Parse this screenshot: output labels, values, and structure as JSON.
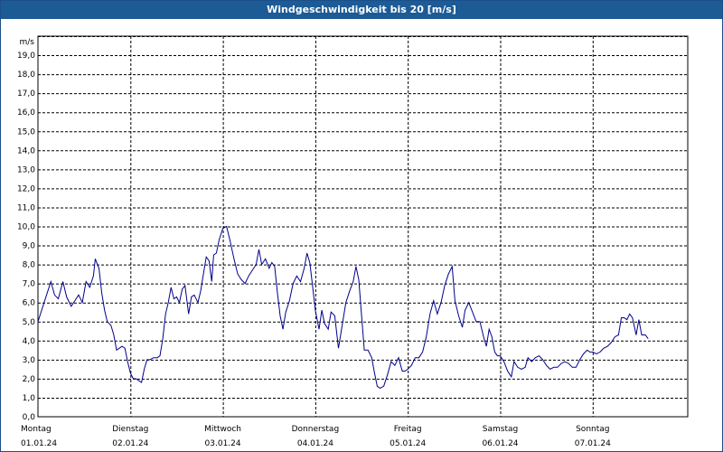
{
  "window": {
    "title": "Windgeschwindigkeit bis 20 [m/s]"
  },
  "chart_data": {
    "type": "line",
    "title": "Windgeschwindigkeit bis 20 [m/s]",
    "ylabel": "m/s",
    "xlabel": "",
    "ylim": [
      0,
      20
    ],
    "grid": true,
    "y_ticks": [
      "0,0",
      "1,0",
      "2,0",
      "3,0",
      "4,0",
      "5,0",
      "6,0",
      "7,0",
      "8,0",
      "9,0",
      "10,0",
      "11,0",
      "12,0",
      "13,0",
      "14,0",
      "15,0",
      "16,0",
      "17,0",
      "18,0",
      "19,0"
    ],
    "x_ticks": [
      {
        "day": "Montag",
        "date": "01.01.24"
      },
      {
        "day": "Dienstag",
        "date": "02.01.24"
      },
      {
        "day": "Mittwoch",
        "date": "03.01.24"
      },
      {
        "day": "Donnerstag",
        "date": "04.01.24"
      },
      {
        "day": "Freitag",
        "date": "05.01.24"
      },
      {
        "day": "Samstag",
        "date": "06.01.24"
      },
      {
        "day": "Sonntag",
        "date": "07.01.24"
      }
    ],
    "series": [
      {
        "color": "#00008b",
        "x_unit": "days since 01.01.24 00:00",
        "points": [
          [
            0.0,
            5.0
          ],
          [
            0.04,
            5.6
          ],
          [
            0.1,
            6.5
          ],
          [
            0.14,
            7.1
          ],
          [
            0.18,
            6.4
          ],
          [
            0.22,
            6.2
          ],
          [
            0.27,
            7.1
          ],
          [
            0.31,
            6.3
          ],
          [
            0.36,
            5.8
          ],
          [
            0.4,
            6.1
          ],
          [
            0.44,
            6.4
          ],
          [
            0.48,
            6.0
          ],
          [
            0.52,
            7.1
          ],
          [
            0.56,
            6.8
          ],
          [
            0.6,
            7.4
          ],
          [
            0.62,
            8.3
          ],
          [
            0.66,
            7.8
          ],
          [
            0.69,
            6.5
          ],
          [
            0.72,
            5.6
          ],
          [
            0.75,
            5.0
          ],
          [
            0.79,
            4.8
          ],
          [
            0.82,
            4.3
          ],
          [
            0.85,
            3.5
          ],
          [
            0.88,
            3.6
          ],
          [
            0.91,
            3.7
          ],
          [
            0.94,
            3.6
          ],
          [
            0.97,
            2.9
          ],
          [
            1.0,
            2.3
          ],
          [
            1.03,
            2.0
          ],
          [
            1.06,
            2.0
          ],
          [
            1.09,
            1.9
          ],
          [
            1.12,
            1.8
          ],
          [
            1.15,
            2.5
          ],
          [
            1.18,
            3.0
          ],
          [
            1.21,
            3.0
          ],
          [
            1.25,
            3.1
          ],
          [
            1.29,
            3.1
          ],
          [
            1.32,
            3.2
          ],
          [
            1.35,
            4.1
          ],
          [
            1.38,
            5.4
          ],
          [
            1.41,
            6.0
          ],
          [
            1.44,
            6.8
          ],
          [
            1.47,
            6.2
          ],
          [
            1.5,
            6.3
          ],
          [
            1.53,
            6.0
          ],
          [
            1.56,
            6.7
          ],
          [
            1.59,
            6.9
          ],
          [
            1.63,
            5.4
          ],
          [
            1.66,
            6.3
          ],
          [
            1.69,
            6.4
          ],
          [
            1.73,
            6.0
          ],
          [
            1.76,
            6.6
          ],
          [
            1.79,
            7.5
          ],
          [
            1.82,
            8.4
          ],
          [
            1.85,
            8.2
          ],
          [
            1.88,
            7.1
          ],
          [
            1.9,
            8.5
          ],
          [
            1.93,
            8.6
          ],
          [
            1.96,
            9.3
          ],
          [
            2.0,
            9.9
          ],
          [
            2.04,
            10.0
          ],
          [
            2.08,
            9.2
          ],
          [
            2.12,
            8.3
          ],
          [
            2.16,
            7.5
          ],
          [
            2.2,
            7.2
          ],
          [
            2.24,
            7.0
          ],
          [
            2.28,
            7.4
          ],
          [
            2.32,
            7.7
          ],
          [
            2.36,
            8.0
          ],
          [
            2.39,
            8.8
          ],
          [
            2.42,
            8.0
          ],
          [
            2.46,
            8.3
          ],
          [
            2.5,
            7.8
          ],
          [
            2.53,
            8.1
          ],
          [
            2.56,
            7.9
          ],
          [
            2.59,
            6.5
          ],
          [
            2.62,
            5.3
          ],
          [
            2.65,
            4.6
          ],
          [
            2.68,
            5.5
          ],
          [
            2.72,
            6.1
          ],
          [
            2.76,
            7.0
          ],
          [
            2.8,
            7.4
          ],
          [
            2.84,
            7.1
          ],
          [
            2.88,
            7.8
          ],
          [
            2.91,
            8.6
          ],
          [
            2.94,
            8.1
          ],
          [
            2.97,
            6.9
          ],
          [
            3.0,
            5.6
          ],
          [
            3.04,
            4.6
          ],
          [
            3.07,
            5.6
          ],
          [
            3.1,
            4.9
          ],
          [
            3.14,
            4.6
          ],
          [
            3.17,
            5.5
          ],
          [
            3.21,
            5.3
          ],
          [
            3.25,
            3.6
          ],
          [
            3.29,
            4.8
          ],
          [
            3.33,
            6.0
          ],
          [
            3.37,
            6.6
          ],
          [
            3.41,
            7.1
          ],
          [
            3.44,
            7.9
          ],
          [
            3.47,
            7.2
          ],
          [
            3.5,
            5.3
          ],
          [
            3.53,
            3.5
          ],
          [
            3.57,
            3.5
          ],
          [
            3.61,
            3.1
          ],
          [
            3.64,
            2.3
          ],
          [
            3.67,
            1.6
          ],
          [
            3.7,
            1.5
          ],
          [
            3.74,
            1.6
          ],
          [
            3.78,
            2.2
          ],
          [
            3.82,
            2.9
          ],
          [
            3.86,
            2.7
          ],
          [
            3.9,
            3.1
          ],
          [
            3.94,
            2.4
          ],
          [
            3.97,
            2.4
          ],
          [
            4.0,
            2.5
          ],
          [
            4.04,
            2.7
          ],
          [
            4.08,
            3.1
          ],
          [
            4.12,
            3.1
          ],
          [
            4.16,
            3.4
          ],
          [
            4.2,
            4.2
          ],
          [
            4.24,
            5.4
          ],
          [
            4.28,
            6.1
          ],
          [
            4.32,
            5.4
          ],
          [
            4.36,
            6.0
          ],
          [
            4.4,
            6.9
          ],
          [
            4.44,
            7.5
          ],
          [
            4.48,
            7.9
          ],
          [
            4.51,
            6.1
          ],
          [
            4.55,
            5.3
          ],
          [
            4.59,
            4.7
          ],
          [
            4.62,
            5.6
          ],
          [
            4.66,
            6.0
          ],
          [
            4.7,
            5.5
          ],
          [
            4.74,
            5.0
          ],
          [
            4.78,
            5.0
          ],
          [
            4.82,
            4.2
          ],
          [
            4.85,
            3.7
          ],
          [
            4.88,
            4.6
          ],
          [
            4.91,
            4.2
          ],
          [
            4.94,
            3.4
          ],
          [
            4.97,
            3.2
          ],
          [
            5.0,
            3.2
          ],
          [
            5.04,
            2.9
          ],
          [
            5.08,
            2.4
          ],
          [
            5.12,
            2.1
          ],
          [
            5.15,
            2.9
          ],
          [
            5.19,
            2.6
          ],
          [
            5.23,
            2.5
          ],
          [
            5.27,
            2.6
          ],
          [
            5.3,
            3.1
          ],
          [
            5.34,
            2.9
          ],
          [
            5.38,
            3.1
          ],
          [
            5.42,
            3.2
          ],
          [
            5.46,
            3.0
          ],
          [
            5.5,
            2.7
          ],
          [
            5.54,
            2.5
          ],
          [
            5.58,
            2.6
          ],
          [
            5.62,
            2.6
          ],
          [
            5.66,
            2.8
          ],
          [
            5.7,
            2.9
          ],
          [
            5.74,
            2.8
          ],
          [
            5.78,
            2.6
          ],
          [
            5.82,
            2.6
          ],
          [
            5.86,
            3.0
          ],
          [
            5.9,
            3.3
          ],
          [
            5.94,
            3.5
          ],
          [
            5.97,
            3.4
          ],
          [
            6.0,
            3.4
          ],
          [
            6.04,
            3.3
          ],
          [
            6.08,
            3.4
          ],
          [
            6.12,
            3.6
          ],
          [
            6.16,
            3.7
          ],
          [
            6.2,
            3.9
          ],
          [
            6.24,
            4.2
          ],
          [
            6.28,
            4.3
          ],
          [
            6.31,
            5.2
          ],
          [
            6.34,
            5.2
          ],
          [
            6.37,
            5.1
          ],
          [
            6.4,
            5.4
          ],
          [
            6.43,
            5.2
          ],
          [
            6.47,
            4.3
          ],
          [
            6.5,
            5.1
          ],
          [
            6.53,
            4.3
          ],
          [
            6.57,
            4.3
          ],
          [
            6.6,
            4.1
          ]
        ]
      }
    ]
  }
}
